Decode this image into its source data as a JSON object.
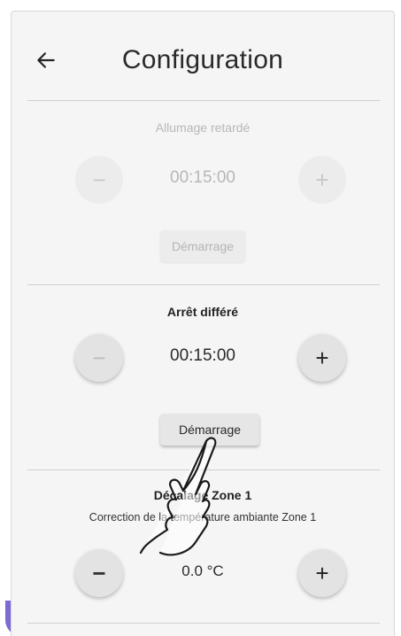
{
  "header": {
    "back_icon": "arrow-left-icon",
    "title": "Configuration"
  },
  "delayed_start": {
    "title": "Allumage retardé",
    "value": "00:15:00",
    "minus": "−",
    "plus": "+",
    "button": "Démarrage",
    "state": "disabled"
  },
  "delayed_stop": {
    "title": "Arrêt différé",
    "value": "00:15:00",
    "minus": "−",
    "plus": "+",
    "button": "Démarrage",
    "state": "enabled"
  },
  "zone1_offset": {
    "title": "Décalage Zone 1",
    "subtitle": "Correction de la température ambiante Zone 1",
    "value": "0.0 °C",
    "minus": "−",
    "plus": "+"
  },
  "overlay": {
    "icon": "hand-pointer-icon"
  },
  "colors": {
    "panel_bg": "#f5f5f5",
    "button_bg": "#e3e3e3",
    "disabled_text": "#b7b7b7",
    "accent_edge": "#7c6bd6"
  }
}
